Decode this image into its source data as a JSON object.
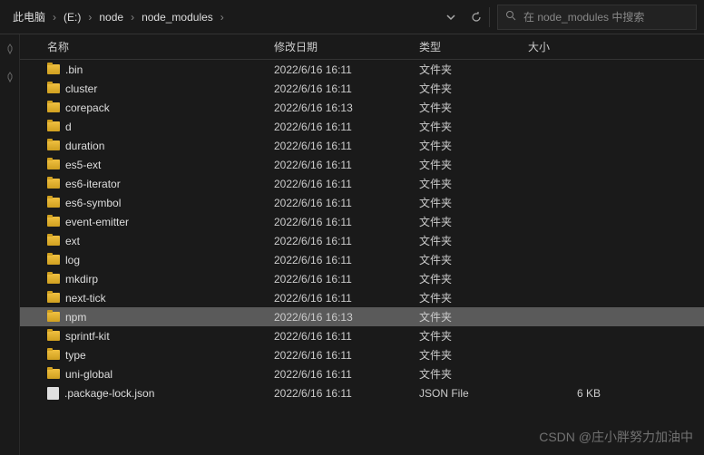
{
  "breadcrumb": [
    "此电脑",
    "(E:)",
    "node",
    "node_modules"
  ],
  "search": {
    "placeholder": "在 node_modules 中搜索"
  },
  "columns": {
    "name": "名称",
    "date": "修改日期",
    "type": "类型",
    "size": "大小"
  },
  "rows": [
    {
      "name": ".bin",
      "date": "2022/6/16 16:11",
      "type": "文件夹",
      "size": "",
      "kind": "folder",
      "selected": false
    },
    {
      "name": "cluster",
      "date": "2022/6/16 16:11",
      "type": "文件夹",
      "size": "",
      "kind": "folder",
      "selected": false
    },
    {
      "name": "corepack",
      "date": "2022/6/16 16:13",
      "type": "文件夹",
      "size": "",
      "kind": "folder",
      "selected": false
    },
    {
      "name": "d",
      "date": "2022/6/16 16:11",
      "type": "文件夹",
      "size": "",
      "kind": "folder",
      "selected": false
    },
    {
      "name": "duration",
      "date": "2022/6/16 16:11",
      "type": "文件夹",
      "size": "",
      "kind": "folder",
      "selected": false
    },
    {
      "name": "es5-ext",
      "date": "2022/6/16 16:11",
      "type": "文件夹",
      "size": "",
      "kind": "folder",
      "selected": false
    },
    {
      "name": "es6-iterator",
      "date": "2022/6/16 16:11",
      "type": "文件夹",
      "size": "",
      "kind": "folder",
      "selected": false
    },
    {
      "name": "es6-symbol",
      "date": "2022/6/16 16:11",
      "type": "文件夹",
      "size": "",
      "kind": "folder",
      "selected": false
    },
    {
      "name": "event-emitter",
      "date": "2022/6/16 16:11",
      "type": "文件夹",
      "size": "",
      "kind": "folder",
      "selected": false
    },
    {
      "name": "ext",
      "date": "2022/6/16 16:11",
      "type": "文件夹",
      "size": "",
      "kind": "folder",
      "selected": false
    },
    {
      "name": "log",
      "date": "2022/6/16 16:11",
      "type": "文件夹",
      "size": "",
      "kind": "folder",
      "selected": false
    },
    {
      "name": "mkdirp",
      "date": "2022/6/16 16:11",
      "type": "文件夹",
      "size": "",
      "kind": "folder",
      "selected": false
    },
    {
      "name": "next-tick",
      "date": "2022/6/16 16:11",
      "type": "文件夹",
      "size": "",
      "kind": "folder",
      "selected": false
    },
    {
      "name": "npm",
      "date": "2022/6/16 16:13",
      "type": "文件夹",
      "size": "",
      "kind": "folder",
      "selected": true
    },
    {
      "name": "sprintf-kit",
      "date": "2022/6/16 16:11",
      "type": "文件夹",
      "size": "",
      "kind": "folder",
      "selected": false
    },
    {
      "name": "type",
      "date": "2022/6/16 16:11",
      "type": "文件夹",
      "size": "",
      "kind": "folder",
      "selected": false
    },
    {
      "name": "uni-global",
      "date": "2022/6/16 16:11",
      "type": "文件夹",
      "size": "",
      "kind": "folder",
      "selected": false
    },
    {
      "name": ".package-lock.json",
      "date": "2022/6/16 16:11",
      "type": "JSON File",
      "size": "6 KB",
      "kind": "json",
      "selected": false
    }
  ],
  "watermark": "CSDN @庄小胖努力加油中"
}
